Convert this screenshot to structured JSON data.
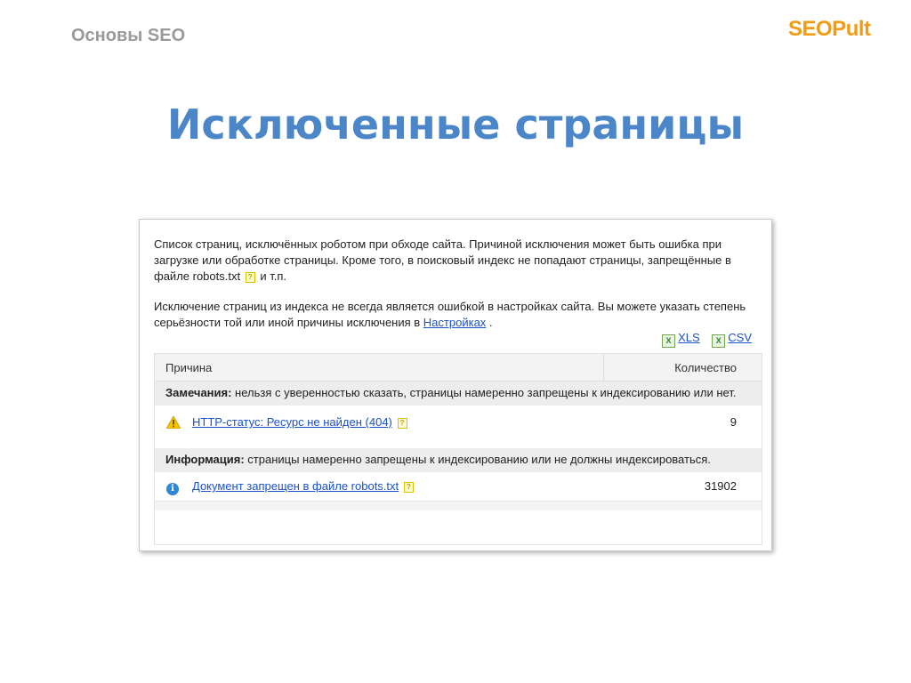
{
  "slide": {
    "course_label": "Основы SEO",
    "brand_logo": "SEOPult",
    "title": "Исключенные страницы"
  },
  "screenshot": {
    "para1_a": "Список страниц, исключённых роботом при обходе сайта. Причиной исключения может быть ошибка при загрузке или обработке страницы. Кроме того, в поисковый индекс не попадают страницы, запрещённые в файле robots.txt",
    "para1_b": " и т.п.",
    "para2_a": "Исключение страниц из индекса не всегда является ошибкой в настройках сайта. Вы можете указать степень серьёзности той или иной причины исключения в ",
    "para2_link": "Настройках",
    "para2_c": ".",
    "help_glyph": "?",
    "export": {
      "icon_glyph": "X",
      "xls": "XLS",
      "csv": "CSV"
    },
    "table": {
      "col_reason": "Причина",
      "col_count": "Количество",
      "sections": [
        {
          "heading": "Замечания:",
          "text": " нельзя с уверенностью сказать, страницы намеренно запрещены к индексированию или нет.",
          "row": {
            "icon": "warning-icon",
            "label": "HTTP-статус: Ресурс не найден (404)",
            "count": "9"
          }
        },
        {
          "heading": "Информация:",
          "text": " страницы намеренно запрещены к индексированию или не должны индексироваться.",
          "row": {
            "icon": "info-icon",
            "label": "Документ запрещен в файле robots.txt",
            "count": "31902",
            "icon_glyph": "i"
          }
        }
      ]
    },
    "colors": {
      "title": "#4a86c8",
      "link": "#1a52c8",
      "logo": "#f39c12",
      "warning": "#f5c400",
      "info": "#2e86d6"
    }
  }
}
